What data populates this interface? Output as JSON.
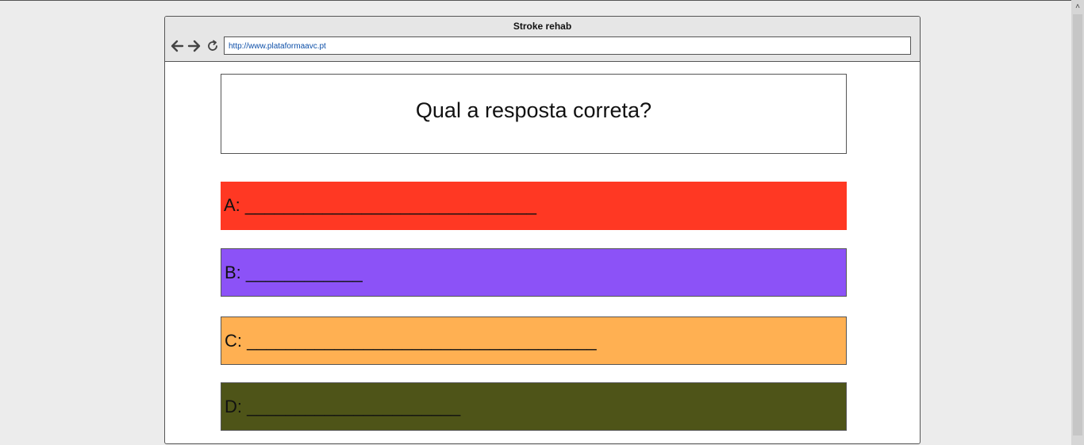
{
  "window": {
    "title": "Stroke rehab",
    "url": "http://www.plataformaavc.pt"
  },
  "nav": {
    "back_icon": "arrow-left-icon",
    "forward_icon": "arrow-right-icon",
    "reload_icon": "reload-icon"
  },
  "question": {
    "text": "Qual a resposta correta?"
  },
  "answers": [
    {
      "label": "A: ______________________________",
      "color": "#ff3823"
    },
    {
      "label": "B: ____________",
      "color": "#8c52f7"
    },
    {
      "label": "C: ____________________________________",
      "color": "#ffb052"
    },
    {
      "label": "D: ______________________",
      "color": "#4e5418"
    }
  ]
}
